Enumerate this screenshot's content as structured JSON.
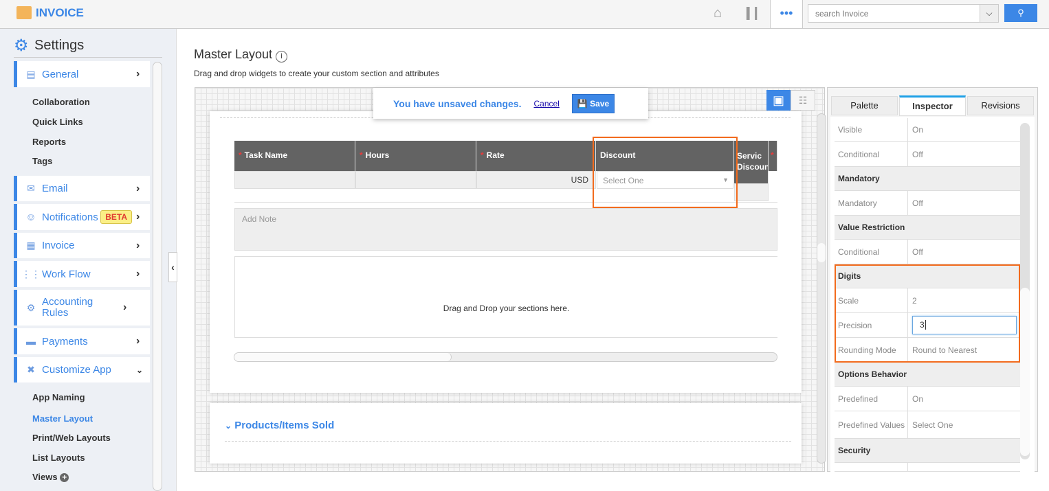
{
  "header": {
    "app_name": "INVOICE",
    "search_placeholder": "search Invoice"
  },
  "sidebar": {
    "title": "Settings",
    "items": [
      {
        "label": "General"
      },
      {
        "label": "Email"
      },
      {
        "label": "Notifications",
        "badge": "BETA"
      },
      {
        "label": "Invoice"
      },
      {
        "label": "Work Flow"
      },
      {
        "label": "Accounting Rules"
      },
      {
        "label": "Payments"
      },
      {
        "label": "Customize App"
      }
    ],
    "general_sub": [
      "Collaboration",
      "Quick Links",
      "Reports",
      "Tags"
    ],
    "customize_sub": [
      "App Naming",
      "Master Layout",
      "Print/Web Layouts",
      "List Layouts",
      "Views"
    ]
  },
  "main": {
    "title": "Master Layout",
    "subtitle": "Drag and drop widgets to create your custom section and attributes",
    "toast": {
      "message": "You have unsaved changes.",
      "cancel": "Cancel",
      "save": "Save"
    },
    "columns": [
      "Task Name",
      "Hours",
      "Rate",
      "Discount",
      "Servic Discoun"
    ],
    "currency": "USD",
    "select_placeholder": "Select One",
    "note_placeholder": "Add Note",
    "drop_text": "Drag and Drop your sections here.",
    "section_title": "Products/Items Sold"
  },
  "inspector": {
    "tabs": [
      "Palette",
      "Inspector",
      "Revisions"
    ],
    "rows": [
      {
        "k": "Visible",
        "v": "On"
      },
      {
        "k": "Conditional",
        "v": "Off"
      },
      {
        "h": "Mandatory"
      },
      {
        "k": "Mandatory",
        "v": "Off"
      },
      {
        "h": "Value Restriction"
      },
      {
        "k": "Conditional",
        "v": "Off"
      },
      {
        "h": "Digits"
      },
      {
        "k": "Scale",
        "v": "2"
      },
      {
        "k": "Precision",
        "v": "3"
      },
      {
        "k": "Rounding Mode",
        "v": "Round to Nearest"
      },
      {
        "h": "Options Behavior"
      },
      {
        "k": "Predefined",
        "v": "On"
      },
      {
        "k": "Predefined Values",
        "v": "Select One"
      },
      {
        "h": "Security"
      }
    ]
  }
}
